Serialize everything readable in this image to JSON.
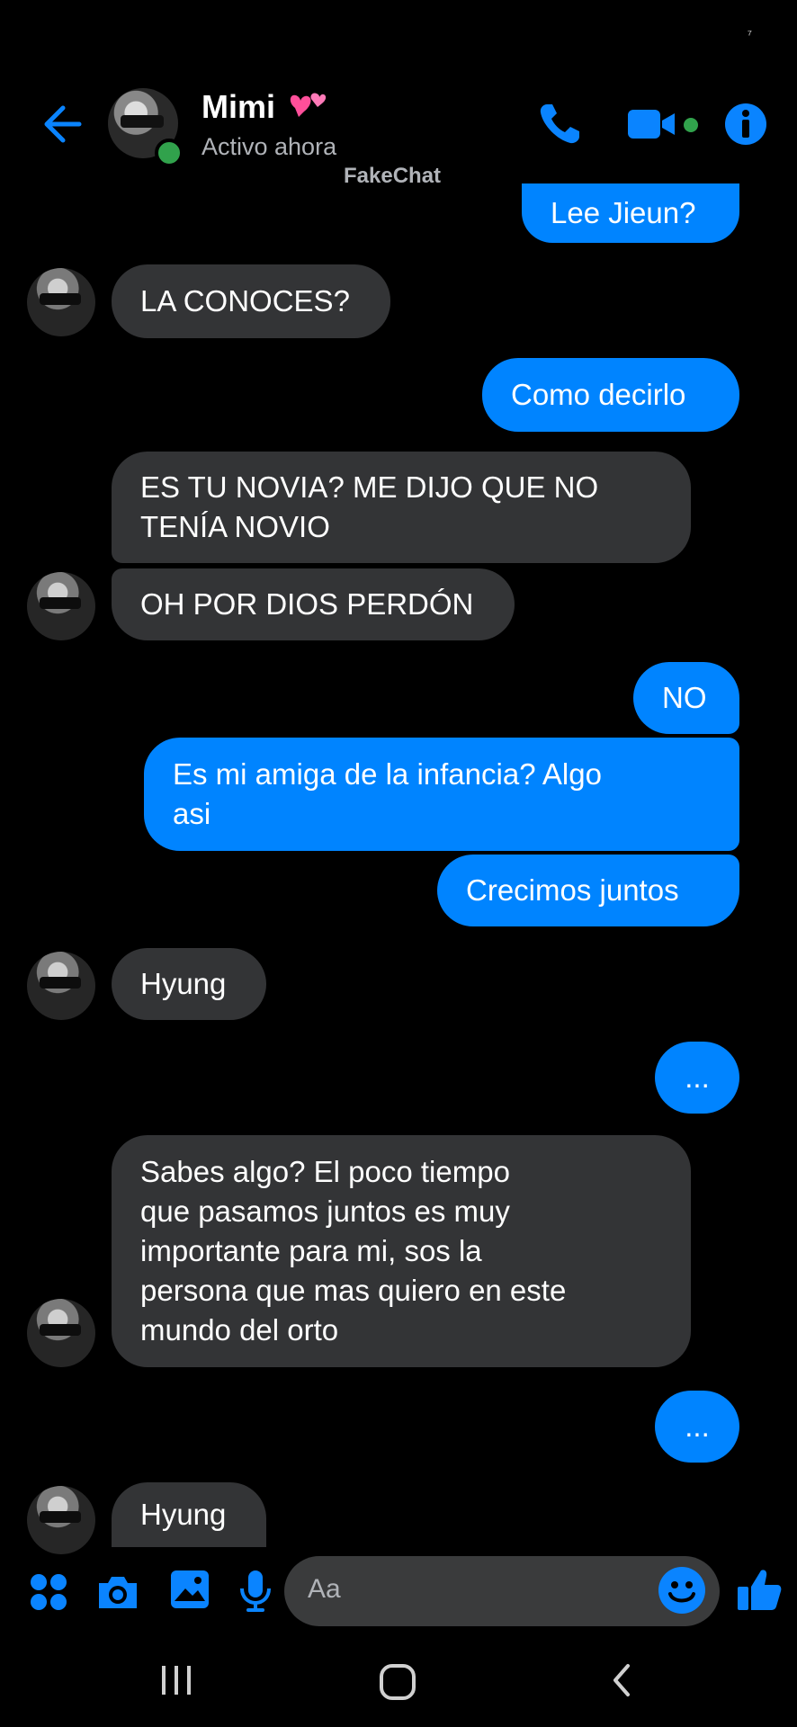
{
  "status_bar": {
    "indicator": "⁷"
  },
  "header": {
    "name": "Mimi",
    "status": "Activo ahora",
    "watermark": "FakeChat",
    "accent": "#0084ff",
    "online_color": "#31a24c"
  },
  "messages": [
    {
      "from": "me",
      "text": "Lee Jieun?"
    },
    {
      "from": "them",
      "text": "LA CONOCES?"
    },
    {
      "from": "me",
      "text": "Como decirlo"
    },
    {
      "from": "them",
      "text": "ES TU NOVIA? ME DIJO QUE NO\nTENÍA NOVIO"
    },
    {
      "from": "them",
      "text": "OH POR DIOS PERDÓN"
    },
    {
      "from": "me",
      "text": "NO"
    },
    {
      "from": "me",
      "text": "Es mi amiga de la infancia? Algo\nasi"
    },
    {
      "from": "me",
      "text": "Crecimos juntos"
    },
    {
      "from": "them",
      "text": "Hyung"
    },
    {
      "from": "me",
      "text": "..."
    },
    {
      "from": "them",
      "text": "Sabes algo? El poco tiempo\nque pasamos juntos es muy\nimportante para mi, sos la\npersona que mas quiero en este\nmundo del orto"
    },
    {
      "from": "me",
      "text": "..."
    },
    {
      "from": "them",
      "text": "Hyung"
    }
  ],
  "composer": {
    "placeholder": "Aa"
  },
  "icons": {
    "header": [
      "back-arrow-icon",
      "phone-icon",
      "video-camera-icon",
      "info-icon"
    ],
    "composer": [
      "apps-icon",
      "camera-icon",
      "gallery-icon",
      "microphone-icon",
      "emoji-icon",
      "thumbs-up-icon"
    ],
    "navbar": [
      "recent-apps-icon",
      "home-icon",
      "back-icon"
    ]
  }
}
